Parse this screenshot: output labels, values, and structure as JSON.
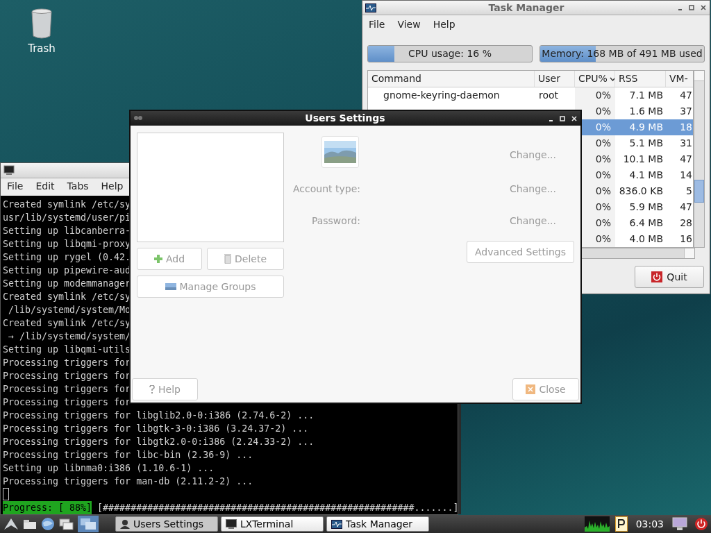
{
  "desktop_icons": [
    {
      "label": "Trash"
    }
  ],
  "task_manager": {
    "title": "Task Manager",
    "menu": [
      "File",
      "View",
      "Help"
    ],
    "cpu": {
      "text": "CPU usage: 16 %",
      "level": 0.16
    },
    "memory": {
      "text": "Memory: 168 MB of 491 MB used",
      "level": 0.34
    },
    "columns": [
      {
        "label": "Command",
        "sorted": false
      },
      {
        "label": "User",
        "sorted": false
      },
      {
        "label": "CPU%",
        "sorted": true
      },
      {
        "label": "RSS",
        "sorted": false
      },
      {
        "label": "VM-",
        "sorted": false
      }
    ],
    "rows": [
      {
        "command": "gnome-keyring-daemon",
        "user": "root",
        "cpu": "0%",
        "rss": "7.1 MB",
        "vm": "47",
        "selected": false
      },
      {
        "cpu": "0%",
        "rss": "1.6 MB",
        "vm": "37",
        "selected": false
      },
      {
        "cpu": "0%",
        "rss": "4.9 MB",
        "vm": "18",
        "selected": true
      },
      {
        "cpu": "0%",
        "rss": "5.1 MB",
        "vm": "31",
        "selected": false
      },
      {
        "cpu": "0%",
        "rss": "10.1 MB",
        "vm": "47",
        "selected": false
      },
      {
        "cpu": "0%",
        "rss": "4.1 MB",
        "vm": "14",
        "selected": false
      },
      {
        "cpu": "0%",
        "rss": "836.0 KB",
        "vm": "5",
        "selected": false
      },
      {
        "cpu": "0%",
        "rss": "5.9 MB",
        "vm": "47",
        "selected": false
      },
      {
        "cpu": "0%",
        "rss": "6.4 MB",
        "vm": "28",
        "selected": false
      },
      {
        "cpu": "0%",
        "rss": "4.0 MB",
        "vm": "16",
        "selected": false
      }
    ],
    "quit": "Quit"
  },
  "terminal": {
    "menu": [
      "File",
      "Edit",
      "Tabs",
      "Help"
    ],
    "lines": [
      "Created symlink /etc/sy",
      "usr/lib/systemd/user/pi",
      "Setting up libcanberra-",
      "Setting up libqmi-proxy",
      "Setting up rygel (0.42.",
      "Setting up pipewire-aud",
      "Setting up modemmanager",
      "Created symlink /etc/sy",
      " /lib/systemd/system/Mo",
      "Created symlink /etc/sy",
      " → /lib/systemd/system/",
      "Setting up libqmi-utils",
      "Processing triggers for",
      "Processing triggers for",
      "Processing triggers for",
      "Processing triggers for",
      "Processing triggers for libglib2.0-0:i386 (2.74.6-2) ...",
      "Processing triggers for libgtk-3-0:i386 (3.24.37-2) ...",
      "Processing triggers for libgtk2.0-0:i386 (2.24.33-2) ...",
      "Processing triggers for libc-bin (2.36-9) ...",
      "Setting up libnma0:i386 (1.10.6-1) ...",
      "Processing triggers for man-db (2.11.2-2) ..."
    ],
    "progress": {
      "label": "Progress: [ 88%]",
      "bar": "[########################################################.......]"
    }
  },
  "users_settings": {
    "title": "Users Settings",
    "change_links": [
      "Change...",
      "Change...",
      "Change..."
    ],
    "fields": [
      "Account type:",
      "Password:"
    ],
    "buttons": [
      {
        "kind": "add",
        "label": "Add",
        "disabled": true
      },
      {
        "kind": "delete",
        "label": "Delete",
        "disabled": true
      },
      {
        "kind": "groups",
        "label": "Manage Groups",
        "disabled": true
      },
      {
        "kind": "advanced",
        "label": "Advanced Settings",
        "disabled": true
      },
      {
        "kind": "help",
        "label": "Help",
        "disabled": true
      },
      {
        "kind": "close",
        "label": "Close",
        "disabled": true
      }
    ]
  },
  "taskbar": {
    "tasks": [
      {
        "kind": "users",
        "label": "Users Settings",
        "selected": true
      },
      {
        "kind": "terminal",
        "label": "LXTerminal",
        "selected": false
      },
      {
        "kind": "taskmgr",
        "label": "Task Manager",
        "selected": false
      }
    ],
    "clock": "03:03"
  }
}
